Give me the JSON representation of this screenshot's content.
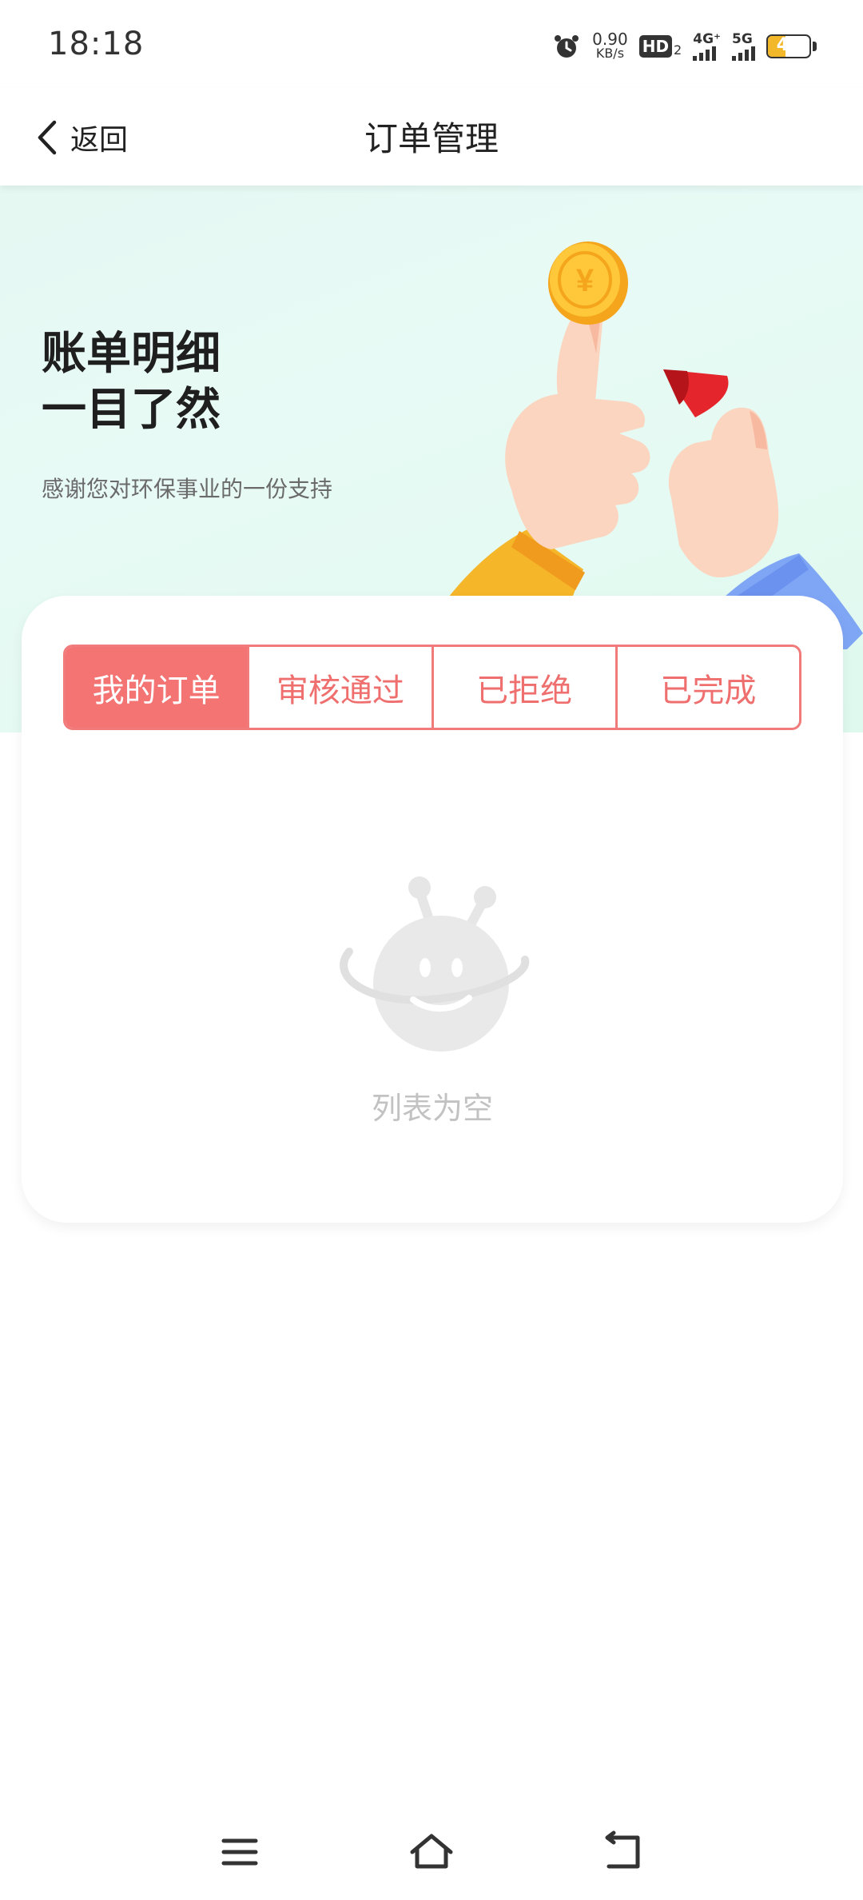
{
  "status_bar": {
    "time": "18:18",
    "net_speed_value": "0.90",
    "net_speed_unit": "KB/s",
    "hd_label": "HD",
    "hd_sub": "2",
    "net1_label": "4G⁺",
    "net2_label": "5G",
    "battery_level": "42",
    "battery_color": "#f2b829",
    "icons": [
      "alarm-icon",
      "hd-icon",
      "signal-icon",
      "battery-icon"
    ]
  },
  "header": {
    "back_label": "返回",
    "title": "订单管理"
  },
  "banner": {
    "title_line1": "账单明细",
    "title_line2": "一目了然",
    "subtitle": "感谢您对环保事业的一份支持",
    "coin_symbol": "¥"
  },
  "tabs": [
    {
      "label": "我的订单",
      "active": true
    },
    {
      "label": "审核通过",
      "active": false
    },
    {
      "label": "已拒绝",
      "active": false
    },
    {
      "label": "已完成",
      "active": false
    }
  ],
  "empty_state": {
    "text": "列表为空",
    "icon": "empty-robot-icon"
  },
  "colors": {
    "accent": "#f47474",
    "banner_bg": "#e6f8f2",
    "empty_text": "#c2c2c2"
  },
  "nav_bar": {
    "icons": [
      "menu-icon",
      "home-icon",
      "back-nav-icon"
    ]
  }
}
